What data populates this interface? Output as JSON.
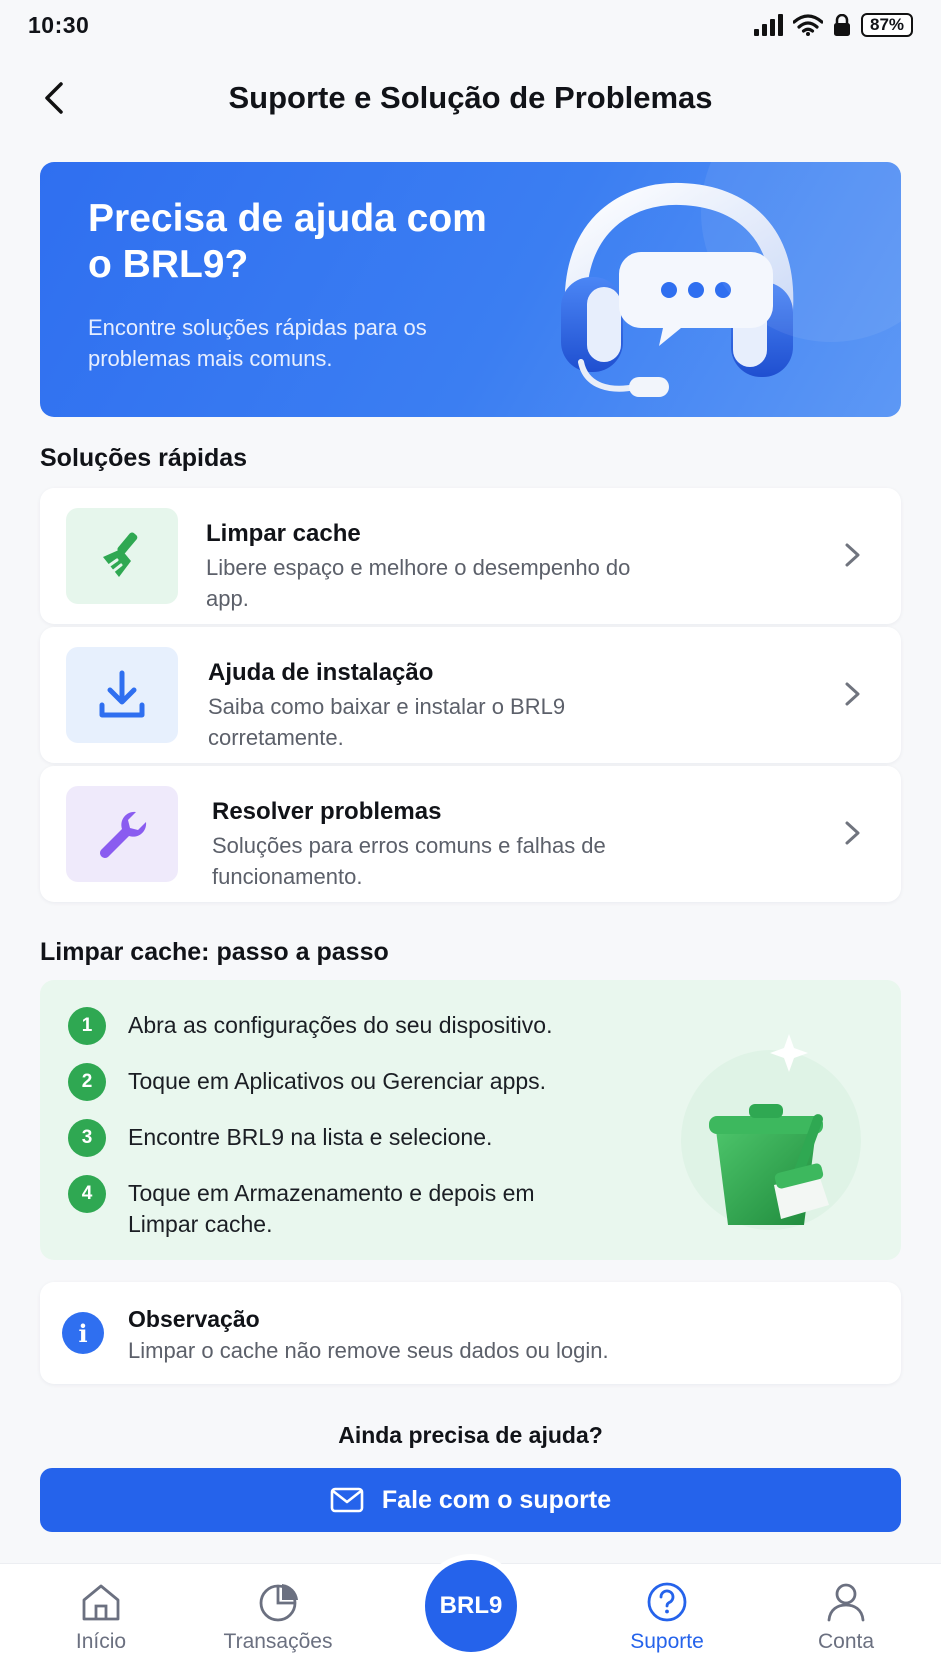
{
  "status_bar": {
    "time": "10:30",
    "battery": "87%"
  },
  "header": {
    "title": "Suporte e Solução de Problemas"
  },
  "hero": {
    "title": "Precisa de ajuda com o BRL9?",
    "subtitle": "Encontre soluções rápidas para os problemas mais comuns."
  },
  "quick_solutions": {
    "title": "Soluções rápidas",
    "items": [
      {
        "title": "Limpar cache",
        "description": "Libere espaço e melhore o desempenho do app.",
        "icon": "broom-icon",
        "icon_bg": "#e6f6ec",
        "icon_color": "#2fa852"
      },
      {
        "title": "Ajuda de instalação",
        "description": "Saiba como baixar e instalar o BRL9 corretamente.",
        "icon": "download-icon",
        "icon_bg": "#e7f0fd",
        "icon_color": "#2f6ff0"
      },
      {
        "title": "Resolver problemas",
        "description": "Soluções para erros comuns e falhas de funcionamento.",
        "icon": "wrench-icon",
        "icon_bg": "#efeafb",
        "icon_color": "#8a5cf0"
      }
    ]
  },
  "steps": {
    "title": "Limpar cache: passo a passo",
    "items": [
      {
        "number": "1",
        "text": "Abra as configurações do seu dispositivo."
      },
      {
        "number": "2",
        "text": "Toque em Aplicativos ou Gerenciar apps."
      },
      {
        "number": "3",
        "text": "Encontre BRL9 na lista e selecione."
      },
      {
        "number": "4",
        "text": "Toque em Armazenamento e depois em Limpar cache."
      }
    ]
  },
  "note": {
    "icon": "info-icon",
    "icon_glyph": "i",
    "title": "Observação",
    "text": "Limpar o cache não remove seus dados ou login."
  },
  "help": {
    "prompt": "Ainda precisa de ajuda?",
    "button_label": "Fale com o suporte"
  },
  "bottom_nav": {
    "items": [
      {
        "label": "Início",
        "icon": "home-icon",
        "active": false
      },
      {
        "label": "Transações",
        "icon": "pie-chart-icon",
        "active": false
      },
      {
        "label": "Suporte",
        "icon": "help-circle-icon",
        "active": true
      },
      {
        "label": "Conta",
        "icon": "user-icon",
        "active": false
      }
    ],
    "center_label": "BRL9"
  },
  "colors": {
    "primary": "#2563eb",
    "success": "#2fa852"
  }
}
